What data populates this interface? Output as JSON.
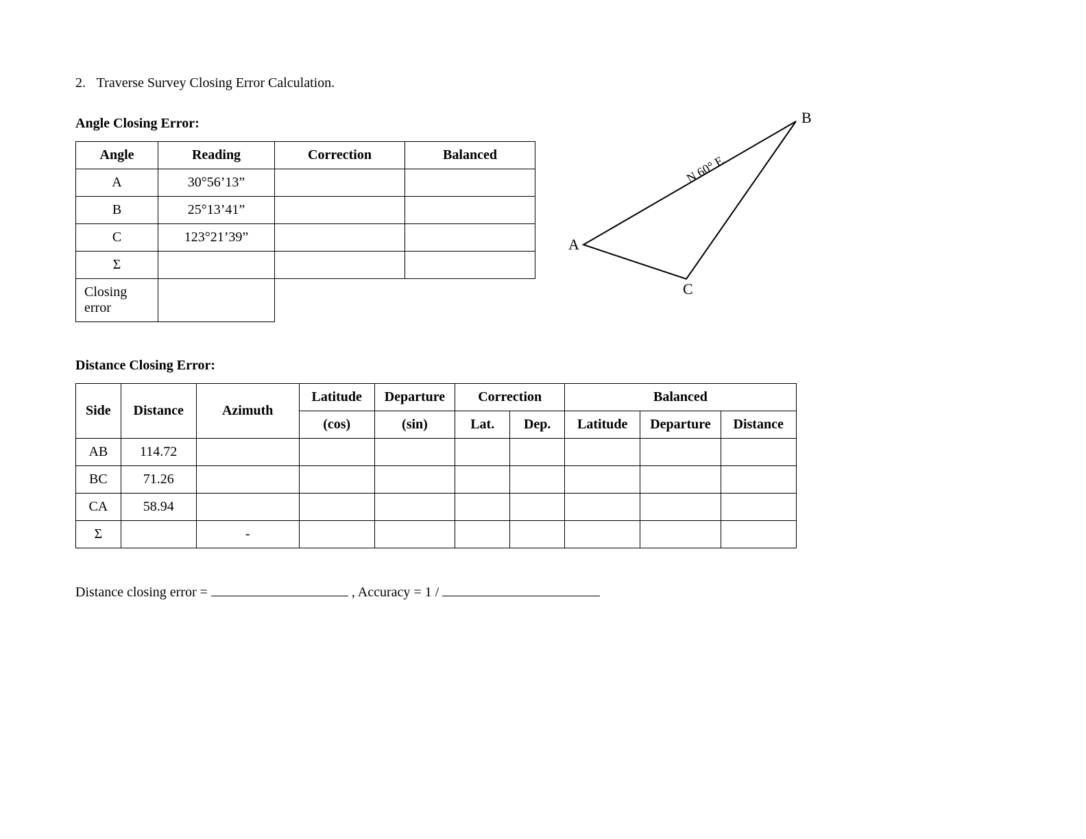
{
  "title": {
    "number": "2.",
    "text": "Traverse Survey Closing Error Calculation."
  },
  "angle_section": {
    "heading": "Angle Closing Error:",
    "headers": {
      "angle": "Angle",
      "reading": "Reading",
      "correction": "Correction",
      "balanced": "Balanced"
    },
    "rows": [
      {
        "angle": "A",
        "reading": "30°56’13”",
        "correction": "",
        "balanced": ""
      },
      {
        "angle": "B",
        "reading": "25°13’41”",
        "correction": "",
        "balanced": ""
      },
      {
        "angle": "C",
        "reading": "123°21’39”",
        "correction": "",
        "balanced": ""
      },
      {
        "angle": "Σ",
        "reading": "",
        "correction": "",
        "balanced": ""
      }
    ],
    "closing_label": "Closing error",
    "closing_value": ""
  },
  "triangle": {
    "label_A": "A",
    "label_B": "B",
    "label_C": "C",
    "bearing": "N 60° E"
  },
  "distance_section": {
    "heading": "Distance Closing Error:",
    "headers": {
      "side": "Side",
      "distance": "Distance",
      "azimuth": "Azimuth",
      "latitude": "Latitude",
      "departure": "Departure",
      "lat_sub": "(cos)",
      "dep_sub": "(sin)",
      "correction": "Correction",
      "cor_lat": "Lat.",
      "cor_dep": "Dep.",
      "balanced": "Balanced",
      "bal_lat": "Latitude",
      "bal_dep": "Departure",
      "bal_dist": "Distance"
    },
    "rows": [
      {
        "side": "AB",
        "distance": "114.72",
        "azimuth": "",
        "lat": "",
        "dep": "",
        "corlat": "",
        "cordep": "",
        "blat": "",
        "bdep": "",
        "bdist": ""
      },
      {
        "side": "BC",
        "distance": "71.26",
        "azimuth": "",
        "lat": "",
        "dep": "",
        "corlat": "",
        "cordep": "",
        "blat": "",
        "bdep": "",
        "bdist": ""
      },
      {
        "side": "CA",
        "distance": "58.94",
        "azimuth": "",
        "lat": "",
        "dep": "",
        "corlat": "",
        "cordep": "",
        "blat": "",
        "bdep": "",
        "bdist": ""
      },
      {
        "side": "Σ",
        "distance": "",
        "azimuth": "-",
        "lat": "",
        "dep": "",
        "corlat": "",
        "cordep": "",
        "blat": "",
        "bdep": "",
        "bdist": ""
      }
    ]
  },
  "footer": {
    "dce_label": "Distance closing error = ",
    "accuracy_label": ", Accuracy = 1 / "
  }
}
